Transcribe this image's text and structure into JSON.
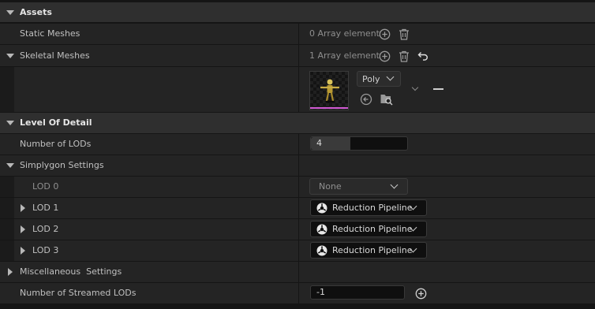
{
  "assets": {
    "title": "Assets",
    "static_meshes": {
      "label": "Static Meshes",
      "count": "0 Array element"
    },
    "skeletal_meshes": {
      "label": "Skeletal Meshes",
      "count": "1 Array element"
    },
    "mesh_entry": {
      "combo_label": "Poly"
    }
  },
  "lod": {
    "title": "Level Of Detail",
    "number_of_lods": {
      "label": "Number of LODs",
      "value": "4"
    },
    "simplygon": {
      "label": "Simplygon Settings"
    },
    "lod0": {
      "label": "LOD 0",
      "value": "None"
    },
    "lod1": {
      "label": "LOD 1",
      "value": "Reduction Pipeline"
    },
    "lod2": {
      "label": "LOD 2",
      "value": "Reduction Pipeline"
    },
    "lod3": {
      "label": "LOD 3",
      "value": "Reduction Pipeline"
    },
    "misc": {
      "label": "Miscellaneous  Settings"
    },
    "streamed": {
      "label": "Number of Streamed LODs",
      "value": "-1"
    }
  },
  "colors": {
    "background": "#151515",
    "category": "#2f2f2f",
    "property_row": "#242424",
    "thumbnail_accent": "#d25bd4"
  },
  "icons": [
    "collapse-arrow-icon",
    "expand-arrow-icon",
    "add-icon",
    "delete-icon",
    "reset-icon",
    "browse-icon",
    "find-in-browser-icon",
    "chevron-down-icon",
    "pipeline-icon",
    "minus-icon"
  ]
}
